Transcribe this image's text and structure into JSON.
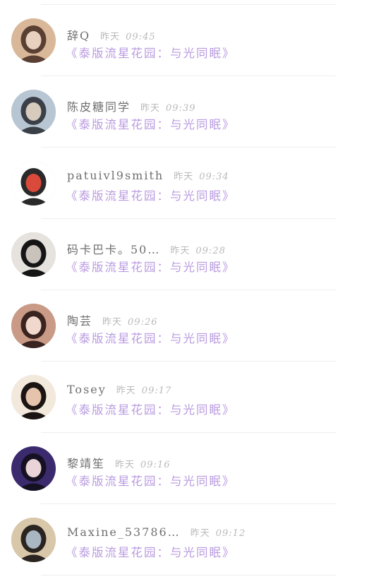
{
  "items": [
    {
      "name": "辞Q",
      "day": "昨天",
      "time": "09:45",
      "subtitle": "《泰版流星花园：与光同眠》",
      "avatar_colors": [
        "#d9b89a",
        "#5a3f33",
        "#e8d2bf"
      ]
    },
    {
      "name": "陈皮糖同学",
      "day": "昨天",
      "time": "09:39",
      "subtitle": "《泰版流星花园：与光同眠》",
      "avatar_colors": [
        "#b8c6d4",
        "#3b3f48",
        "#d7cbbd"
      ]
    },
    {
      "name": "patuivl9smith",
      "day": "昨天",
      "time": "09:34",
      "subtitle": "《泰版流星花园：与光同眠》",
      "avatar_colors": [
        "#ffffff",
        "#2a2a2a",
        "#d94a3a"
      ]
    },
    {
      "name": "码卡巴卡。50…",
      "day": "昨天",
      "time": "09:28",
      "subtitle": "《泰版流星花园：与光同眠》",
      "avatar_colors": [
        "#e6e2dd",
        "#151515",
        "#c9c3bc"
      ]
    },
    {
      "name": "陶芸",
      "day": "昨天",
      "time": "09:26",
      "subtitle": "《泰版流星花园：与光同眠》",
      "avatar_colors": [
        "#c99a86",
        "#3a2420",
        "#f0d8cc"
      ]
    },
    {
      "name": "Tosey",
      "day": "昨天",
      "time": "09:17",
      "subtitle": "《泰版流星花园：与光同眠》",
      "avatar_colors": [
        "#f3e8dc",
        "#1b1412",
        "#e6c3ad"
      ]
    },
    {
      "name": "黎靖笙",
      "day": "昨天",
      "time": "09:16",
      "subtitle": "《泰版流星花园：与光同眠》",
      "avatar_colors": [
        "#3b2a6d",
        "#151122",
        "#e9d4d8"
      ]
    },
    {
      "name": "Maxine_53786…",
      "day": "昨天",
      "time": "09:12",
      "subtitle": "《泰版流星花园：与光同眠》",
      "avatar_colors": [
        "#d8c7a8",
        "#2b2521",
        "#a9b7c2"
      ]
    }
  ]
}
